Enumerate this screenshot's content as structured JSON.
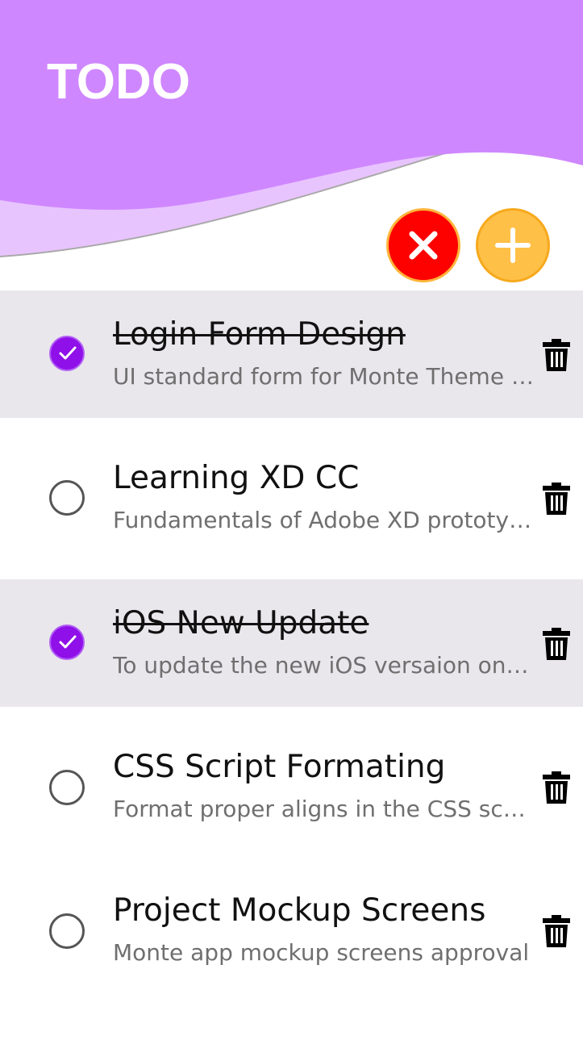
{
  "header": {
    "title": "TODO",
    "colors": {
      "primary": "#cf87ff",
      "wave_light": "#e8c4ff",
      "clear": "#fd0000",
      "add": "#ffc048"
    }
  },
  "actions": {
    "clear_icon": "close-icon",
    "add_icon": "plus-icon"
  },
  "tasks": [
    {
      "title": "Login Form Design",
      "description": "UI standard form for Monte Theme designs",
      "done": true
    },
    {
      "title": "Learning XD CC",
      "description": "Fundamentals of Adobe XD prototyping",
      "done": false
    },
    {
      "title": "iOS New Update",
      "description": "To update the new iOS versaion on devices",
      "done": true
    },
    {
      "title": "CSS Script Formating",
      "description": "Format proper aligns in the CSS script file",
      "done": false
    },
    {
      "title": "Project Mockup Screens",
      "description": "Monte app mockup screens approval",
      "done": false
    }
  ]
}
